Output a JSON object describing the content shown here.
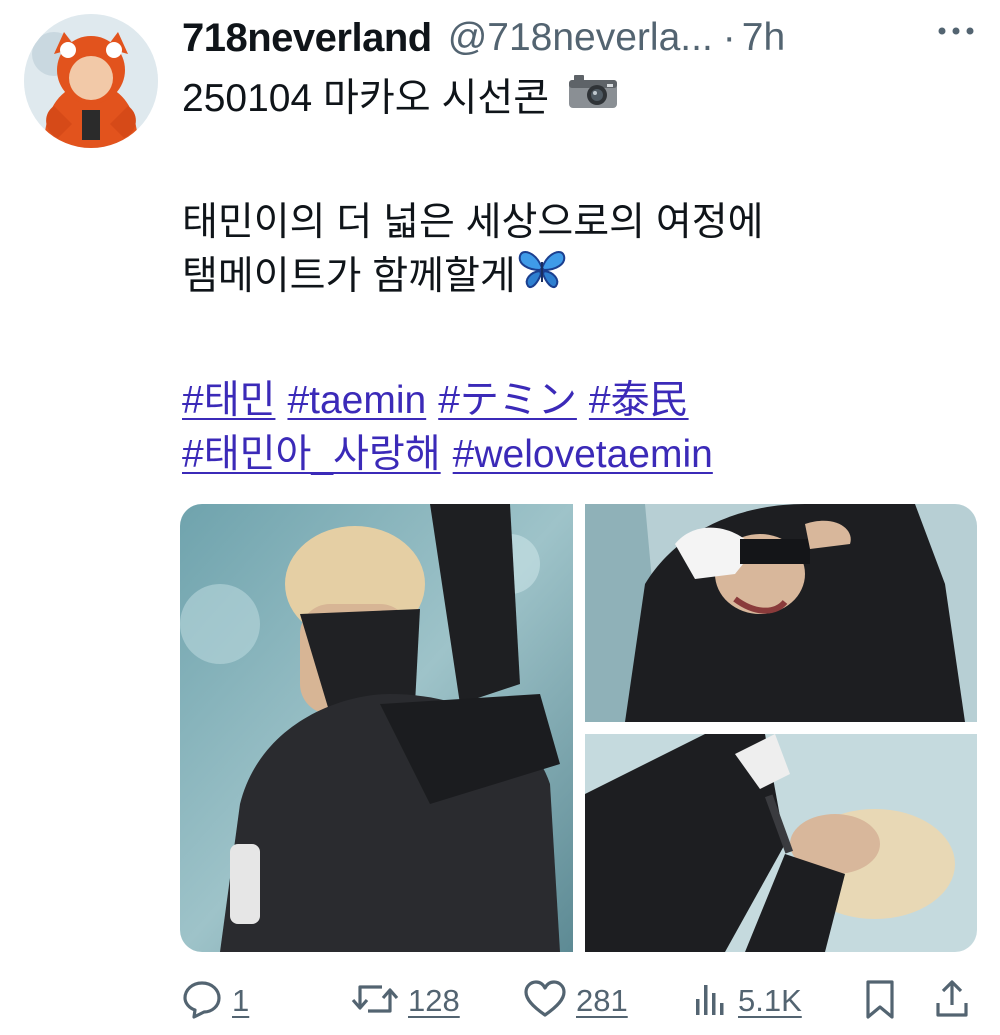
{
  "tweet": {
    "display_name": "718neverland",
    "handle": "@718neverla...",
    "separator": "·",
    "time": "7h",
    "line1": "250104  마카오 시선콘",
    "line2": "태민이의 더 넓은 세상으로의 여정에",
    "line3": "탬메이트가 함께할게",
    "hashtags_row1": [
      "#태민",
      "#taemin",
      "#テミン",
      "#泰民"
    ],
    "hashtags_row2": [
      "#태민아_사랑해",
      "#welovetaemin"
    ]
  },
  "actions": {
    "replies": "1",
    "retweets": "128",
    "likes": "281",
    "views": "5.1K"
  },
  "icons": {
    "more": "more-icon",
    "camera": "camera-emoji",
    "butterfly": "butterfly-emoji",
    "reply": "reply-icon",
    "retweet": "retweet-icon",
    "like": "heart-icon",
    "views": "views-icon",
    "bookmark": "bookmark-icon",
    "share": "share-icon"
  },
  "colors": {
    "link": "#3b2ab8",
    "muted": "#536471",
    "text": "#0f1419"
  }
}
